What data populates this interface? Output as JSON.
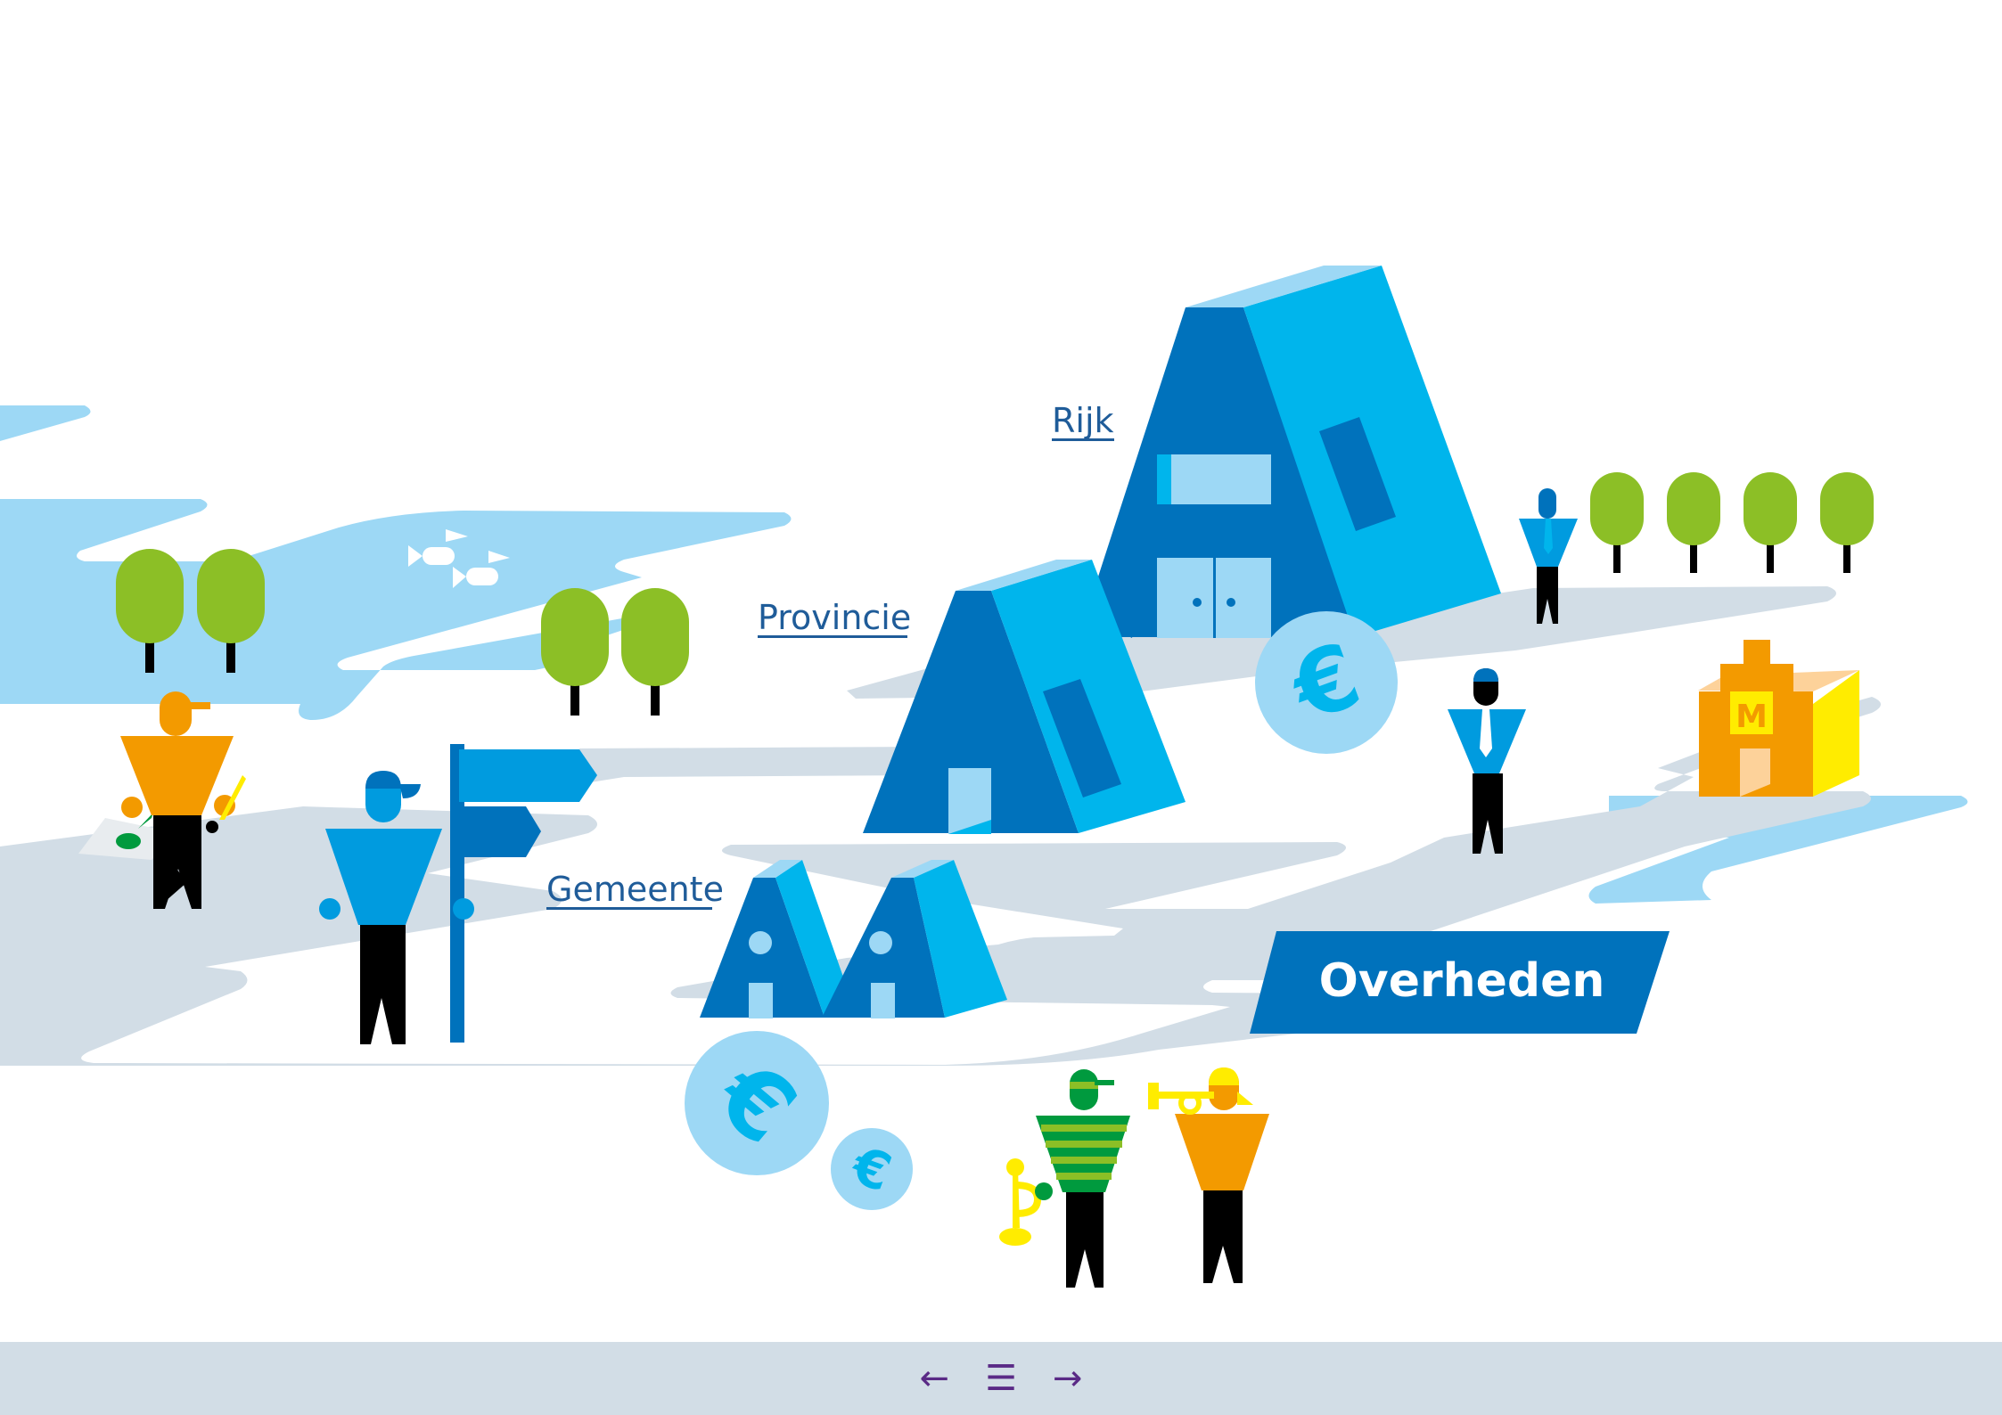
{
  "labels": {
    "rijk": "Rijk",
    "provincie": "Provincie",
    "gemeente": "Gemeente"
  },
  "banner": {
    "title": "Overheden"
  },
  "signs": {
    "museum_letter": "M",
    "currency": "€"
  },
  "navigation": {
    "previous": "←",
    "menu": "☰",
    "next": "→"
  },
  "colors": {
    "dark_blue": "#0072bc",
    "mid_blue": "#009bdf",
    "light_blue": "#00b5ec",
    "pale_blue": "#9dd8f5",
    "road_grey": "#d2dde6",
    "tree_green": "#8cbf26",
    "orange": "#f39a00",
    "yellow": "#ffec00",
    "nav_purple": "#5a2a86"
  }
}
